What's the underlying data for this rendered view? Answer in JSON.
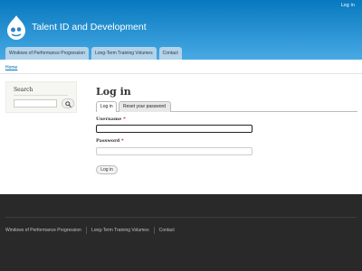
{
  "header": {
    "login_link": "Log in",
    "site_name": "Talent ID and Development",
    "nav_tabs": [
      {
        "label": "Windows of Performance Progression"
      },
      {
        "label": "Long-Term Training Volumes"
      },
      {
        "label": "Contact"
      }
    ],
    "colors": {
      "gradient_top": "#0779bf",
      "gradient_bottom": "#48a9e4"
    }
  },
  "breadcrumb": {
    "home": "Home"
  },
  "sidebar": {
    "search_title": "Search",
    "search_button_icon": "search-icon"
  },
  "main": {
    "title": "Log in",
    "tabs": [
      {
        "label": "Log in",
        "active": true
      },
      {
        "label": "Reset your password",
        "active": false
      }
    ],
    "username_label": "Username",
    "password_label": "Password",
    "required_marker": "*",
    "submit_label": "Log in"
  },
  "footer": {
    "menu": [
      {
        "label": "Windows of Performance Progression"
      },
      {
        "label": "Long-Term Training Volumes"
      },
      {
        "label": "Contact"
      }
    ]
  }
}
